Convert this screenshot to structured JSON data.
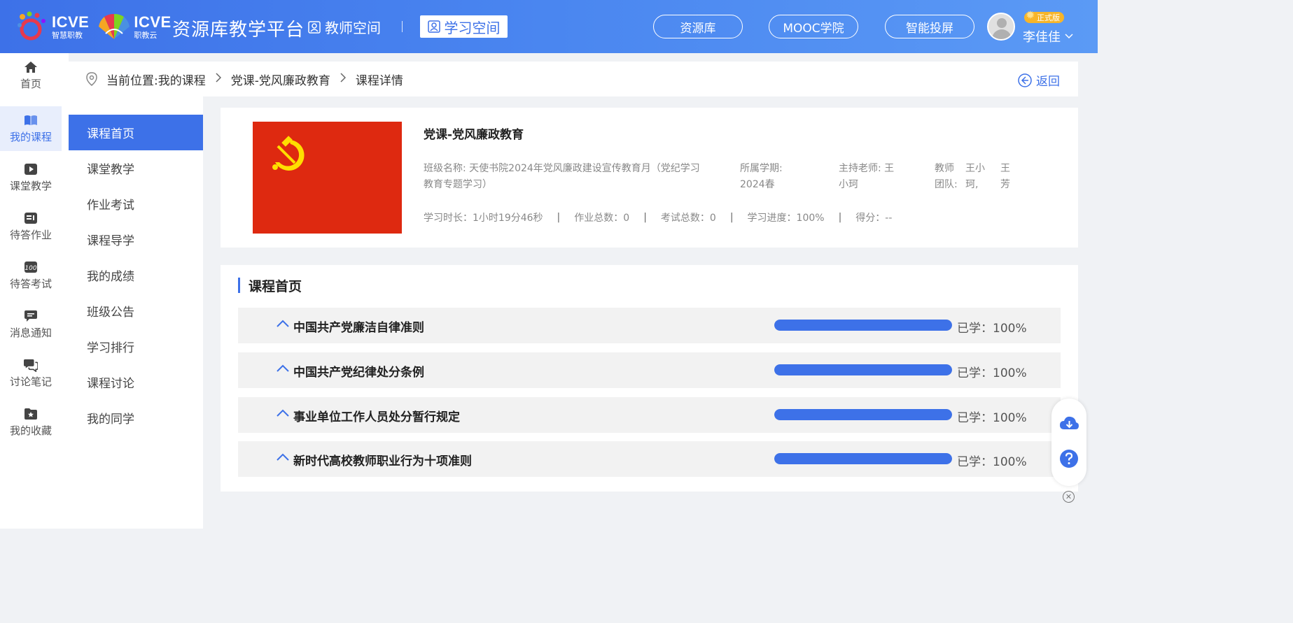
{
  "header": {
    "logo1_text": "ICVE",
    "logo1_sub": "智慧职教",
    "logo2_text": "ICVE",
    "logo2_sub": "职教云",
    "platform_title": "资源库教学平台",
    "teacher_space": "教师空间",
    "study_space": "学习空间",
    "nav": [
      "资源库",
      "MOOC学院",
      "智能投屏"
    ],
    "badge": "正式版",
    "username": "李佳佳"
  },
  "sidebar": {
    "items": [
      {
        "label": "首页",
        "icon": "home-icon"
      },
      {
        "label": "我的课程",
        "icon": "book-icon"
      },
      {
        "label": "课堂教学",
        "icon": "video-icon"
      },
      {
        "label": "待答作业",
        "icon": "homework-icon"
      },
      {
        "label": "待答考试",
        "icon": "exam-icon"
      },
      {
        "label": "消息通知",
        "icon": "message-icon"
      },
      {
        "label": "讨论笔记",
        "icon": "discussion-icon"
      },
      {
        "label": "我的收藏",
        "icon": "favorite-icon"
      }
    ],
    "active_index": 1
  },
  "breadcrumb": {
    "prefix": "当前位置:",
    "items": [
      "我的课程",
      "党课-党风廉政教育",
      "课程详情"
    ],
    "back": "返回"
  },
  "menu": {
    "items": [
      "课程首页",
      "课堂教学",
      "作业考试",
      "课程导学",
      "我的成绩",
      "班级公告",
      "学习排行",
      "课程讨论",
      "我的同学"
    ],
    "active_index": 0
  },
  "course": {
    "title": "党课-党风廉政教育",
    "class_name": "班级名称: 天使书院2024年党风廉政建设宣传教育月（党纪学习教育专题学习）",
    "semester": "所属学期: 2024春",
    "host_teacher": "主持老师: 王小珂",
    "team_label": "教师团队:",
    "team_members": [
      "王小珂,",
      "王芳"
    ],
    "stats": {
      "duration": "学习时长：1小时19分46秒",
      "homework": "作业总数：0",
      "exams": "考试总数：0",
      "progress": "学习进度：100%",
      "score": "得分：--"
    }
  },
  "chapters": {
    "title": "课程首页",
    "items": [
      {
        "title": "中国共产党廉洁自律准则",
        "progress": 100,
        "label": "已学：100%"
      },
      {
        "title": "中国共产党纪律处分条例",
        "progress": 100,
        "label": "已学：100%"
      },
      {
        "title": "事业单位工作人员处分暂行规定",
        "progress": 100,
        "label": "已学：100%"
      },
      {
        "title": "新时代高校教师职业行为十项准则",
        "progress": 100,
        "label": "已学：100%"
      }
    ]
  },
  "colors": {
    "primary": "#3d71e8",
    "flag_red": "#de2910",
    "flag_gold": "#ffde00",
    "badge": "#f7b529"
  }
}
